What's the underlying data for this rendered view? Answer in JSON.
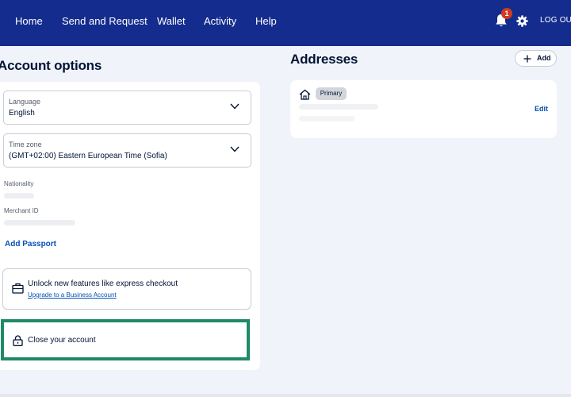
{
  "nav": {
    "home": "Home",
    "send_request": "Send and Request",
    "wallet": "Wallet",
    "activity": "Activity",
    "help": "Help",
    "notification_count": "1",
    "logout": "LOG OUT"
  },
  "account_options": {
    "title": "Account options",
    "language": {
      "label": "Language",
      "value": "English"
    },
    "time_zone": {
      "label": "Time zone",
      "value": "(GMT+02:00) Eastern European Time (Sofia)"
    },
    "nationality_label": "Nationality",
    "merchant_id_label": "Merchant ID",
    "add_passport": "Add Passport",
    "upgrade": {
      "title": "Unlock new features like express checkout",
      "link": "Upgrade to a Business Account"
    },
    "close_account": "Close your account"
  },
  "addresses": {
    "title": "Addresses",
    "add_label": "Add",
    "primary_badge": "Primary",
    "edit": "Edit"
  },
  "colors": {
    "nav_background": "#142c8e",
    "page_background": "#f1f3fb",
    "link_blue": "#0551b5",
    "highlight_green": "#1f8b66",
    "badge_red": "#d03c1d"
  },
  "icons": [
    "bell-icon",
    "gear-icon",
    "chevron-down-icon",
    "briefcase-icon",
    "lock-icon",
    "plus-icon",
    "home-icon"
  ]
}
